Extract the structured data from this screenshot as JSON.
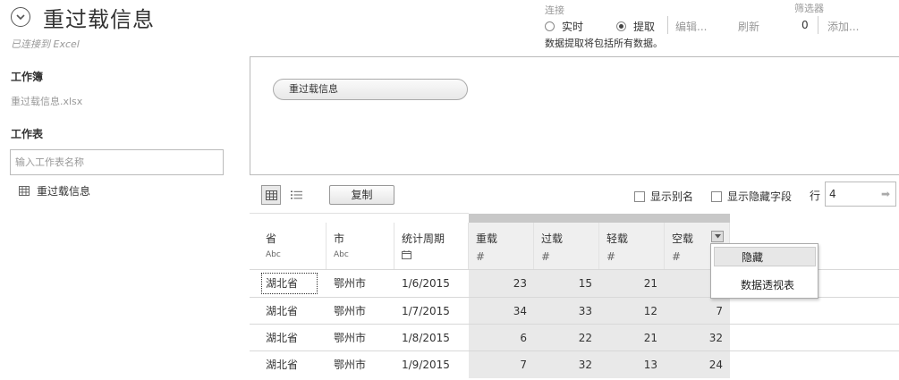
{
  "header": {
    "title": "重过载信息",
    "subtitle": "已连接到 Excel"
  },
  "connection": {
    "label": "连接",
    "live_label": "实时",
    "extract_label": "提取",
    "selected": "提取",
    "edit_label": "编辑...",
    "refresh_label": "刷新",
    "note": "数据提取将包括所有数据。"
  },
  "filters": {
    "label": "筛选器",
    "count": "0",
    "add_label": "添加..."
  },
  "sidebar": {
    "workbook_heading": "工作簿",
    "workbook_file": "重过载信息.xlsx",
    "sheets_heading": "工作表",
    "sheet_search_placeholder": "输入工作表名称",
    "sheets": [
      {
        "label": "重过载信息"
      }
    ]
  },
  "canvas": {
    "table_pill": "重过载信息"
  },
  "toolbar": {
    "copy_label": "复制",
    "show_alias_label": "显示别名",
    "show_hidden_label": "显示隐藏字段",
    "rows_label": "行",
    "rows_value": "4"
  },
  "grid": {
    "columns": [
      {
        "name": "省",
        "type": "Abc"
      },
      {
        "name": "市",
        "type": "Abc"
      },
      {
        "name": "统计周期",
        "type": "calendar-icon"
      },
      {
        "name": "重载",
        "type": "#"
      },
      {
        "name": "过载",
        "type": "#"
      },
      {
        "name": "轻载",
        "type": "#"
      },
      {
        "name": "空载",
        "type": "#"
      }
    ],
    "rows": [
      [
        "湖北省",
        "鄂州市",
        "1/6/2015",
        "23",
        "15",
        "21",
        ""
      ],
      [
        "湖北省",
        "鄂州市",
        "1/7/2015",
        "34",
        "33",
        "12",
        "7"
      ],
      [
        "湖北省",
        "鄂州市",
        "1/8/2015",
        "6",
        "22",
        "21",
        "32"
      ],
      [
        "湖北省",
        "鄂州市",
        "1/9/2015",
        "7",
        "32",
        "13",
        "24"
      ]
    ]
  },
  "context_menu": {
    "items": [
      {
        "label": "隐藏"
      },
      {
        "label": "数据透视表"
      }
    ]
  }
}
